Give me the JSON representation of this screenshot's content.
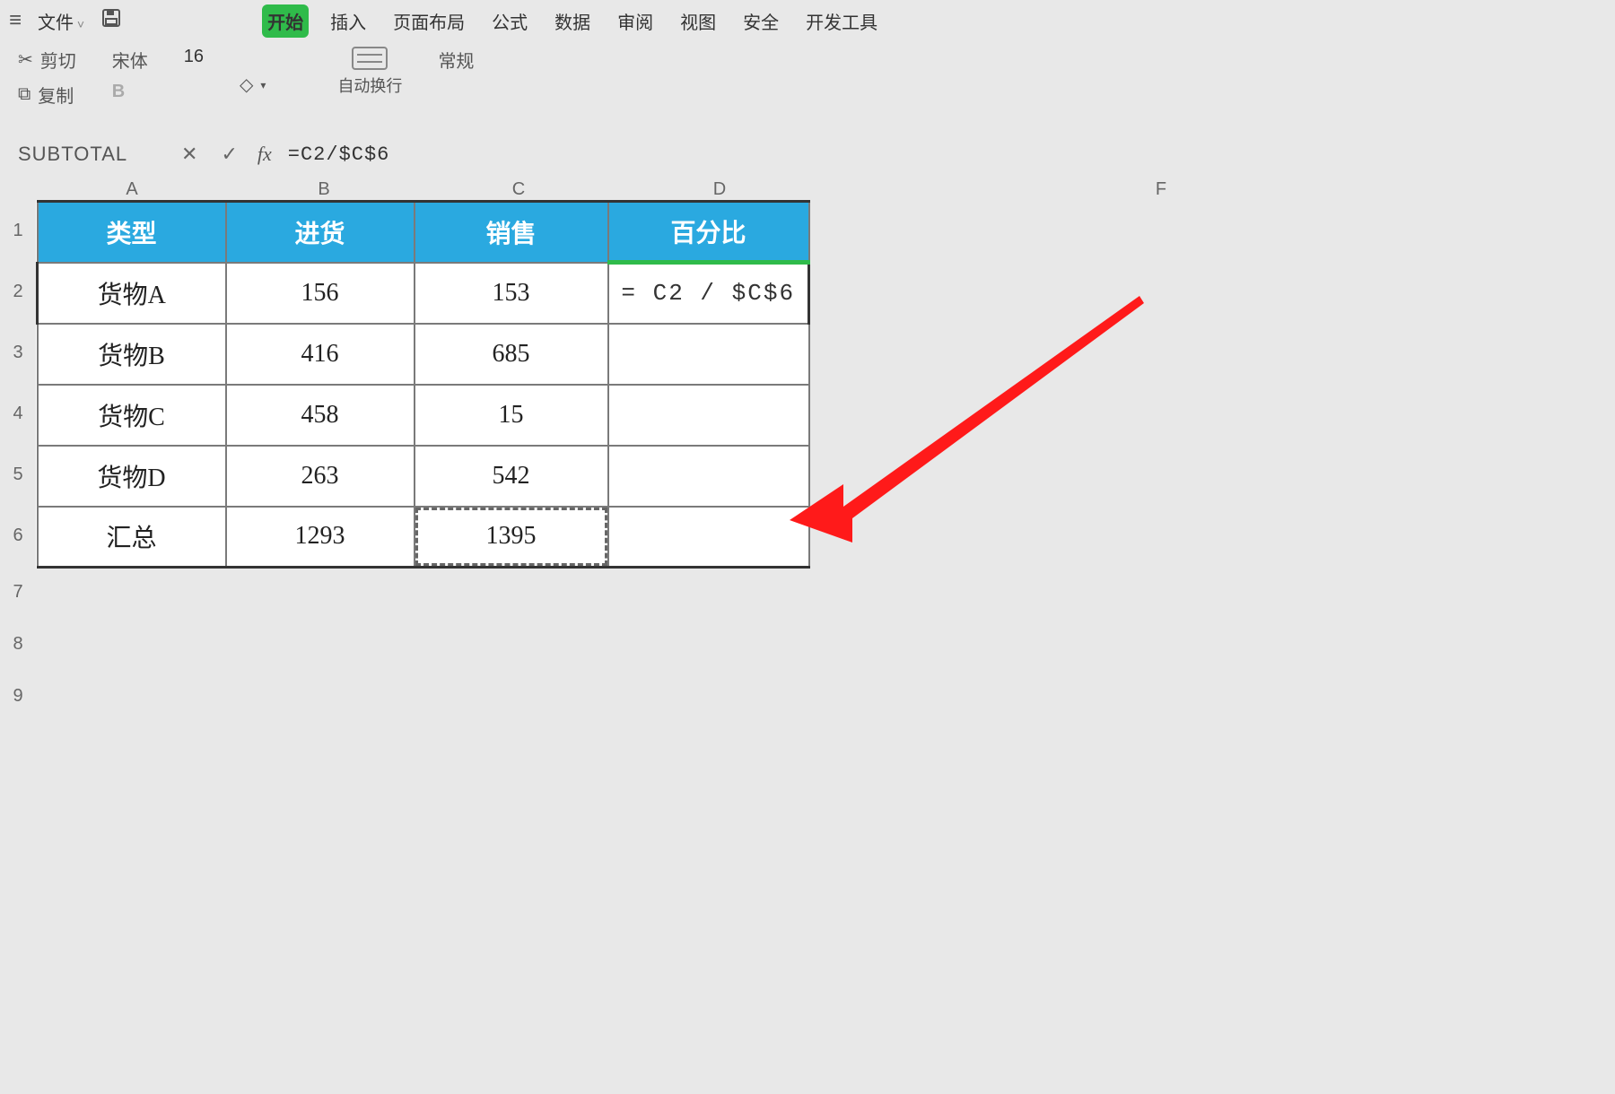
{
  "menu": {
    "file": "文件",
    "tabs": {
      "start": "开始",
      "insert": "插入",
      "pagelayout": "页面布局",
      "formula": "公式",
      "data": "数据",
      "review": "审阅",
      "view": "视图",
      "security": "安全",
      "developer": "开发工具"
    }
  },
  "toolbar": {
    "cut": "剪切",
    "copy": "复制",
    "font_name": "宋体",
    "font_size": "16",
    "wrap_label": "自动换行",
    "format_label": "常规"
  },
  "formula_bar": {
    "name_box": "SUBTOTAL",
    "cancel": "✕",
    "accept": "✓",
    "fx": "fx",
    "formula": "=C2/$C$6"
  },
  "columns": {
    "A": "A",
    "B": "B",
    "C": "C",
    "D": "D",
    "F": "F"
  },
  "rows": [
    "1",
    "2",
    "3",
    "4",
    "5",
    "6",
    "7",
    "8",
    "9"
  ],
  "headers": {
    "A": "类型",
    "B": "进货",
    "C": "销售",
    "D": "百分比"
  },
  "table": [
    {
      "A": "货物A",
      "B": "156",
      "C": "153",
      "D": "= C2 / $C$6"
    },
    {
      "A": "货物B",
      "B": "416",
      "C": "685",
      "D": ""
    },
    {
      "A": "货物C",
      "B": "458",
      "C": "15",
      "D": ""
    },
    {
      "A": "货物D",
      "B": "263",
      "C": "542",
      "D": ""
    },
    {
      "A": "汇总",
      "B": "1293",
      "C": "1395",
      "D": ""
    }
  ]
}
